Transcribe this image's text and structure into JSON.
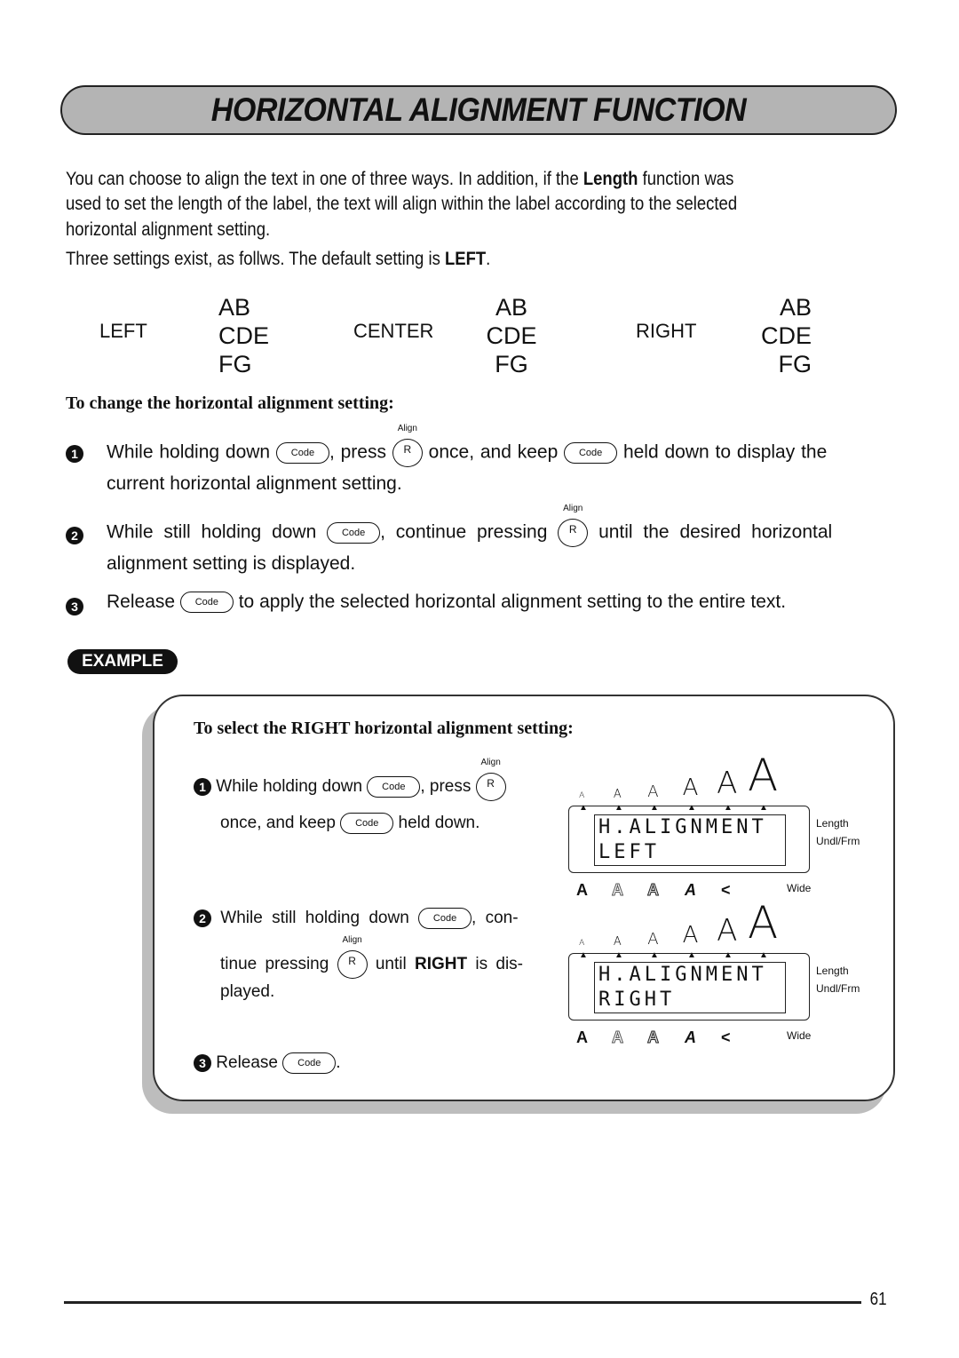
{
  "header": {
    "title": "HORIZONTAL ALIGNMENT FUNCTION"
  },
  "intro": {
    "line1_pre": "You can choose to align the text in one of three ways. In addition, if the ",
    "line1_bold": "Length",
    "line1_post": " function was",
    "line2": "used to set the length of the label, the text will align within the label according to the selected",
    "line3": "horizontal alignment setting.",
    "line4_pre": "Three settings exist, as follws. The default setting is ",
    "line4_bold": "LEFT",
    "line4_post": "."
  },
  "alignments": [
    {
      "label": "LEFT",
      "lines": [
        "AB",
        "CDE",
        "FG"
      ],
      "mode": "left"
    },
    {
      "label": "CENTER",
      "lines": [
        "AB",
        "CDE",
        "FG"
      ],
      "mode": "center"
    },
    {
      "label": "RIGHT",
      "lines": [
        "AB",
        "CDE",
        "FG"
      ],
      "mode": "right"
    }
  ],
  "keys": {
    "code": "Code",
    "r": "R",
    "align_sup": "Align"
  },
  "procedure": {
    "heading": "To change the horizontal alignment setting:",
    "steps": [
      {
        "num": "1",
        "a": "While holding down ",
        "b": ", press ",
        "c": " once, and keep ",
        "d": " held down to display the",
        "e": "current horizontal alignment setting."
      },
      {
        "num": "2",
        "a": "While still holding down ",
        "b": ", continue pressing ",
        "c": " until the desired horizontal",
        "e": "alignment setting is displayed."
      },
      {
        "num": "3",
        "a": "Release ",
        "b": " to apply the selected horizontal alignment setting to the entire text."
      }
    ]
  },
  "example": {
    "badge": "EXAMPLE",
    "heading": "To select the RIGHT horizontal alignment setting:",
    "steps": [
      {
        "num": "1",
        "a": "While holding down ",
        "b": ", press ",
        "c": "once, and keep ",
        "d": " held down."
      },
      {
        "num": "2",
        "a": "While still holding down ",
        "b": ", con-",
        "c": "tinue pressing ",
        "d": " until ",
        "d_bold": "RIGHT",
        "e": " is dis-",
        "f": "played."
      },
      {
        "num": "3",
        "a": "Release ",
        "b": "."
      }
    ],
    "displays": [
      {
        "line1": "H.ALIGNMENT",
        "line2": "LEFT"
      },
      {
        "line1": "H.ALIGNMENT",
        "line2": "RIGHT"
      }
    ],
    "size_indicators": [
      "A",
      "A",
      "A",
      "A",
      "A",
      "A"
    ],
    "style_indicators": [
      "A",
      "A",
      "A",
      "A",
      "<"
    ],
    "side_labels": {
      "length": "Length",
      "undl": "Undl/Frm",
      "wide": "Wide"
    }
  },
  "footer": {
    "page": "61"
  }
}
